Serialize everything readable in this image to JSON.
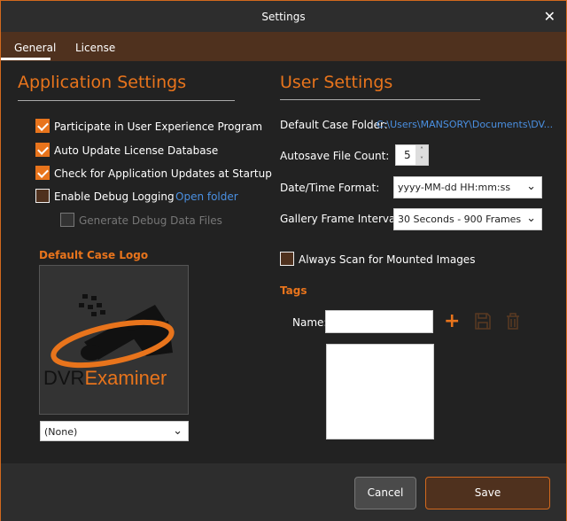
{
  "window": {
    "title": "Settings",
    "close_icon": "close-icon"
  },
  "tabs": [
    {
      "label": "General",
      "active": true
    },
    {
      "label": "License",
      "active": false
    }
  ],
  "app_settings": {
    "heading": "Application Settings",
    "options": [
      {
        "label": "Participate in User Experience Program",
        "checked": true
      },
      {
        "label": "Auto Update License Database",
        "checked": true
      },
      {
        "label": "Check for Application Updates at Startup",
        "checked": true
      },
      {
        "label": "Enable Debug Logging",
        "checked": false
      },
      {
        "label": "Generate Debug Data Files",
        "checked": false,
        "disabled": true
      }
    ],
    "open_folder_link": "Open folder",
    "logo_heading": "Default Case Logo",
    "logo_text_left": "DVR",
    "logo_text_right": "Examiner",
    "logo_select": "(None)"
  },
  "user_settings": {
    "heading": "User Settings",
    "case_folder_label": "Default Case Folder:",
    "case_folder_value": "C:\\Users\\MANSORY\\Documents\\DV...",
    "autosave_label": "Autosave File Count:",
    "autosave_value": "5",
    "datetime_label": "Date/Time Format:",
    "datetime_value": "yyyy-MM-dd HH:mm:ss",
    "gallery_label": "Gallery Frame Interval:",
    "gallery_value": "30 Seconds - 900 Frames",
    "scan_label": "Always Scan for Mounted Images",
    "scan_checked": false,
    "tags_heading": "Tags",
    "name_label": "Name:",
    "name_value": ""
  },
  "footer": {
    "cancel": "Cancel",
    "save": "Save"
  },
  "colors": {
    "accent": "#e8741c",
    "tabbar": "#4f311e",
    "background": "#222222",
    "link": "#4a90e2"
  }
}
